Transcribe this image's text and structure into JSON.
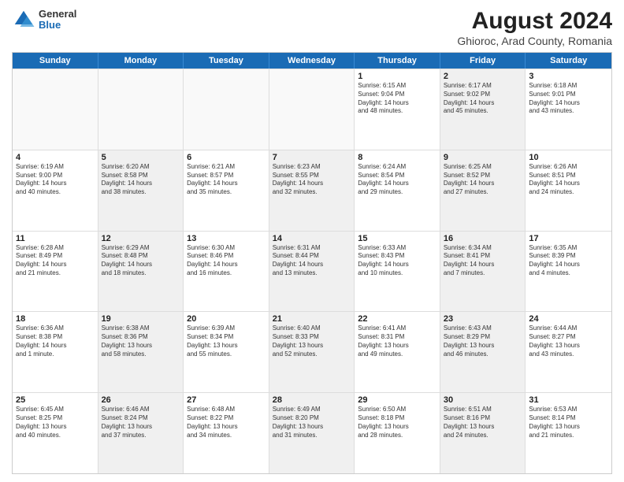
{
  "header": {
    "logo_line1": "General",
    "logo_line2": "Blue",
    "title": "August 2024",
    "subtitle": "Ghioroc, Arad County, Romania"
  },
  "weekdays": [
    "Sunday",
    "Monday",
    "Tuesday",
    "Wednesday",
    "Thursday",
    "Friday",
    "Saturday"
  ],
  "weeks": [
    [
      {
        "day": "",
        "info": "",
        "empty": true,
        "shaded": false
      },
      {
        "day": "",
        "info": "",
        "empty": true,
        "shaded": false
      },
      {
        "day": "",
        "info": "",
        "empty": true,
        "shaded": false
      },
      {
        "day": "",
        "info": "",
        "empty": true,
        "shaded": false
      },
      {
        "day": "1",
        "info": "Sunrise: 6:15 AM\nSunset: 9:04 PM\nDaylight: 14 hours\nand 48 minutes.",
        "empty": false,
        "shaded": false
      },
      {
        "day": "2",
        "info": "Sunrise: 6:17 AM\nSunset: 9:02 PM\nDaylight: 14 hours\nand 45 minutes.",
        "empty": false,
        "shaded": true
      },
      {
        "day": "3",
        "info": "Sunrise: 6:18 AM\nSunset: 9:01 PM\nDaylight: 14 hours\nand 43 minutes.",
        "empty": false,
        "shaded": false
      }
    ],
    [
      {
        "day": "4",
        "info": "Sunrise: 6:19 AM\nSunset: 9:00 PM\nDaylight: 14 hours\nand 40 minutes.",
        "empty": false,
        "shaded": false
      },
      {
        "day": "5",
        "info": "Sunrise: 6:20 AM\nSunset: 8:58 PM\nDaylight: 14 hours\nand 38 minutes.",
        "empty": false,
        "shaded": true
      },
      {
        "day": "6",
        "info": "Sunrise: 6:21 AM\nSunset: 8:57 PM\nDaylight: 14 hours\nand 35 minutes.",
        "empty": false,
        "shaded": false
      },
      {
        "day": "7",
        "info": "Sunrise: 6:23 AM\nSunset: 8:55 PM\nDaylight: 14 hours\nand 32 minutes.",
        "empty": false,
        "shaded": true
      },
      {
        "day": "8",
        "info": "Sunrise: 6:24 AM\nSunset: 8:54 PM\nDaylight: 14 hours\nand 29 minutes.",
        "empty": false,
        "shaded": false
      },
      {
        "day": "9",
        "info": "Sunrise: 6:25 AM\nSunset: 8:52 PM\nDaylight: 14 hours\nand 27 minutes.",
        "empty": false,
        "shaded": true
      },
      {
        "day": "10",
        "info": "Sunrise: 6:26 AM\nSunset: 8:51 PM\nDaylight: 14 hours\nand 24 minutes.",
        "empty": false,
        "shaded": false
      }
    ],
    [
      {
        "day": "11",
        "info": "Sunrise: 6:28 AM\nSunset: 8:49 PM\nDaylight: 14 hours\nand 21 minutes.",
        "empty": false,
        "shaded": false
      },
      {
        "day": "12",
        "info": "Sunrise: 6:29 AM\nSunset: 8:48 PM\nDaylight: 14 hours\nand 18 minutes.",
        "empty": false,
        "shaded": true
      },
      {
        "day": "13",
        "info": "Sunrise: 6:30 AM\nSunset: 8:46 PM\nDaylight: 14 hours\nand 16 minutes.",
        "empty": false,
        "shaded": false
      },
      {
        "day": "14",
        "info": "Sunrise: 6:31 AM\nSunset: 8:44 PM\nDaylight: 14 hours\nand 13 minutes.",
        "empty": false,
        "shaded": true
      },
      {
        "day": "15",
        "info": "Sunrise: 6:33 AM\nSunset: 8:43 PM\nDaylight: 14 hours\nand 10 minutes.",
        "empty": false,
        "shaded": false
      },
      {
        "day": "16",
        "info": "Sunrise: 6:34 AM\nSunset: 8:41 PM\nDaylight: 14 hours\nand 7 minutes.",
        "empty": false,
        "shaded": true
      },
      {
        "day": "17",
        "info": "Sunrise: 6:35 AM\nSunset: 8:39 PM\nDaylight: 14 hours\nand 4 minutes.",
        "empty": false,
        "shaded": false
      }
    ],
    [
      {
        "day": "18",
        "info": "Sunrise: 6:36 AM\nSunset: 8:38 PM\nDaylight: 14 hours\nand 1 minute.",
        "empty": false,
        "shaded": false
      },
      {
        "day": "19",
        "info": "Sunrise: 6:38 AM\nSunset: 8:36 PM\nDaylight: 13 hours\nand 58 minutes.",
        "empty": false,
        "shaded": true
      },
      {
        "day": "20",
        "info": "Sunrise: 6:39 AM\nSunset: 8:34 PM\nDaylight: 13 hours\nand 55 minutes.",
        "empty": false,
        "shaded": false
      },
      {
        "day": "21",
        "info": "Sunrise: 6:40 AM\nSunset: 8:33 PM\nDaylight: 13 hours\nand 52 minutes.",
        "empty": false,
        "shaded": true
      },
      {
        "day": "22",
        "info": "Sunrise: 6:41 AM\nSunset: 8:31 PM\nDaylight: 13 hours\nand 49 minutes.",
        "empty": false,
        "shaded": false
      },
      {
        "day": "23",
        "info": "Sunrise: 6:43 AM\nSunset: 8:29 PM\nDaylight: 13 hours\nand 46 minutes.",
        "empty": false,
        "shaded": true
      },
      {
        "day": "24",
        "info": "Sunrise: 6:44 AM\nSunset: 8:27 PM\nDaylight: 13 hours\nand 43 minutes.",
        "empty": false,
        "shaded": false
      }
    ],
    [
      {
        "day": "25",
        "info": "Sunrise: 6:45 AM\nSunset: 8:25 PM\nDaylight: 13 hours\nand 40 minutes.",
        "empty": false,
        "shaded": false
      },
      {
        "day": "26",
        "info": "Sunrise: 6:46 AM\nSunset: 8:24 PM\nDaylight: 13 hours\nand 37 minutes.",
        "empty": false,
        "shaded": true
      },
      {
        "day": "27",
        "info": "Sunrise: 6:48 AM\nSunset: 8:22 PM\nDaylight: 13 hours\nand 34 minutes.",
        "empty": false,
        "shaded": false
      },
      {
        "day": "28",
        "info": "Sunrise: 6:49 AM\nSunset: 8:20 PM\nDaylight: 13 hours\nand 31 minutes.",
        "empty": false,
        "shaded": true
      },
      {
        "day": "29",
        "info": "Sunrise: 6:50 AM\nSunset: 8:18 PM\nDaylight: 13 hours\nand 28 minutes.",
        "empty": false,
        "shaded": false
      },
      {
        "day": "30",
        "info": "Sunrise: 6:51 AM\nSunset: 8:16 PM\nDaylight: 13 hours\nand 24 minutes.",
        "empty": false,
        "shaded": true
      },
      {
        "day": "31",
        "info": "Sunrise: 6:53 AM\nSunset: 8:14 PM\nDaylight: 13 hours\nand 21 minutes.",
        "empty": false,
        "shaded": false
      }
    ]
  ]
}
